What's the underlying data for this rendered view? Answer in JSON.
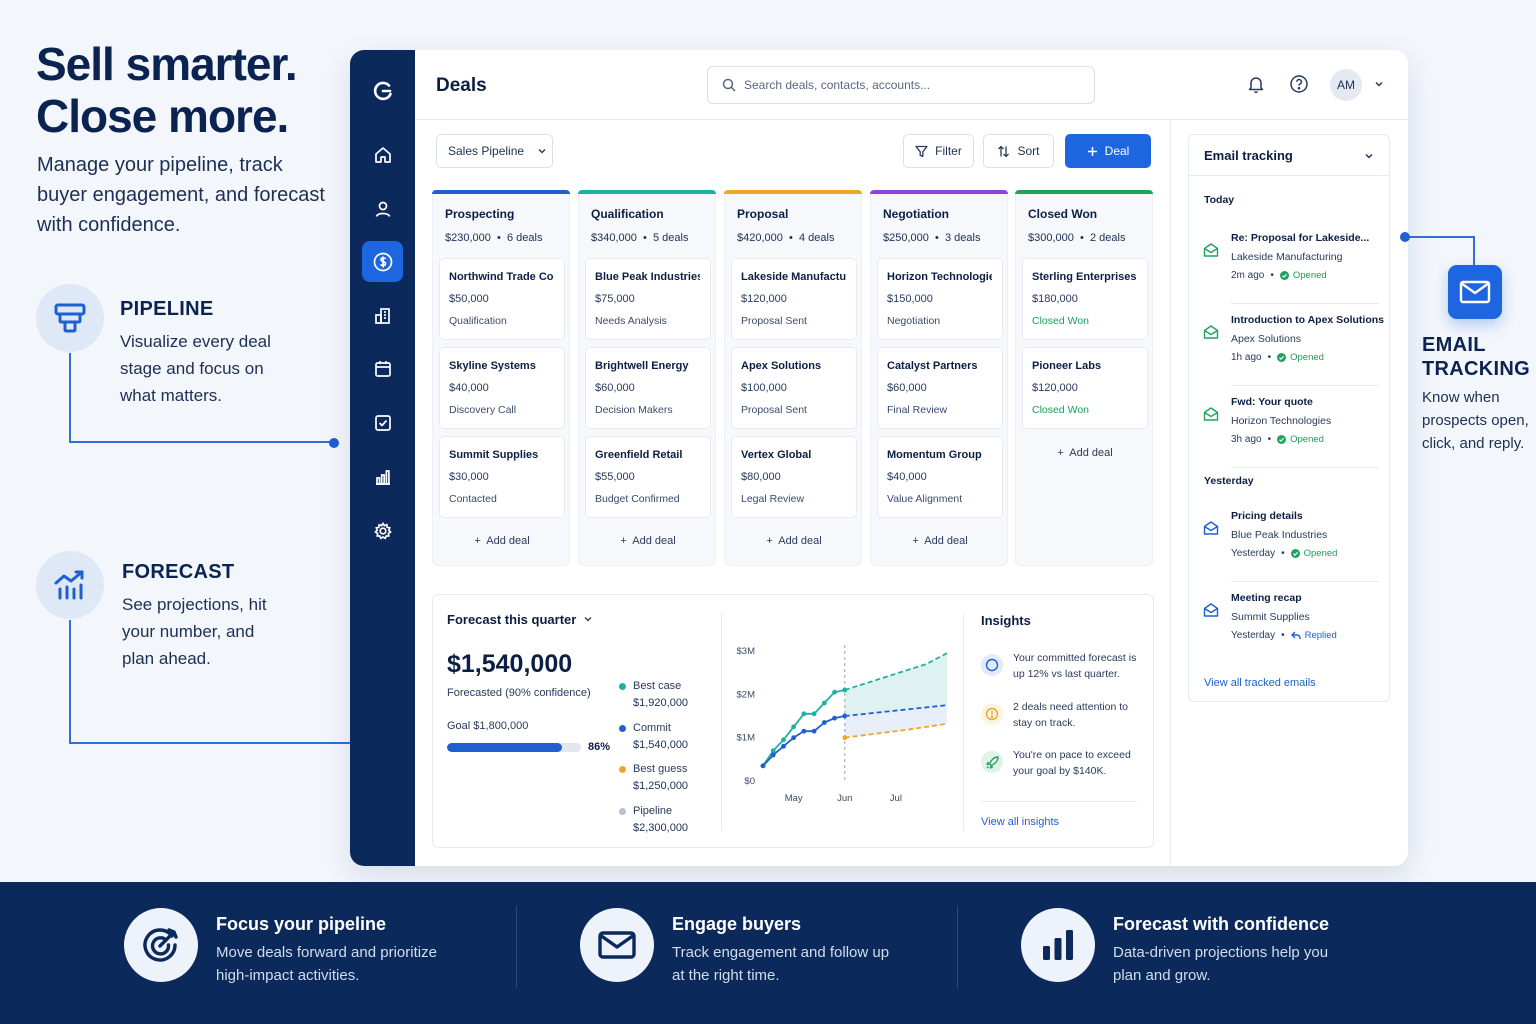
{
  "hero": {
    "title_line1": "Sell smarter.",
    "title_line2": "Close more.",
    "subtitle": "Manage your pipeline, track buyer engagement, and forecast with confidence."
  },
  "features": {
    "pipeline": {
      "title": "PIPELINE",
      "text": "Visualize every deal stage and focus on what matters."
    },
    "forecast": {
      "title": "FORECAST",
      "text": "See projections, hit your number, and plan ahead."
    },
    "email": {
      "title_line1": "EMAIL",
      "title_line2": "TRACKING",
      "text": "Know when prospects open, click, and reply."
    }
  },
  "app": {
    "page_title": "Deals",
    "search_placeholder": "Search deals, contacts, accounts...",
    "avatar_initials": "AM",
    "pipeline_select": "Sales Pipeline",
    "filter_label": "Filter",
    "sort_label": "Sort",
    "new_deal_label": "Deal",
    "add_deal_label": "Add deal",
    "columns": [
      {
        "name": "Prospecting",
        "total": "$230,000",
        "count": "6 deals",
        "color": "#1e5fd2",
        "cards": [
          {
            "name": "Northwind Trade Co.",
            "value": "$50,000",
            "stage": "Qualification"
          },
          {
            "name": "Skyline Systems",
            "value": "$40,000",
            "stage": "Discovery Call"
          },
          {
            "name": "Summit Supplies",
            "value": "$30,000",
            "stage": "Contacted"
          }
        ]
      },
      {
        "name": "Qualification",
        "total": "$340,000",
        "count": "5 deals",
        "color": "#1fb0a3",
        "cards": [
          {
            "name": "Blue Peak Industries",
            "value": "$75,000",
            "stage": "Needs Analysis"
          },
          {
            "name": "Brightwell Energy",
            "value": "$60,000",
            "stage": "Decision Makers"
          },
          {
            "name": "Greenfield Retail",
            "value": "$55,000",
            "stage": "Budget Confirmed"
          }
        ]
      },
      {
        "name": "Proposal",
        "total": "$420,000",
        "count": "4 deals",
        "color": "#f0a526",
        "cards": [
          {
            "name": "Lakeside Manufacturing",
            "value": "$120,000",
            "stage": "Proposal Sent"
          },
          {
            "name": "Apex Solutions",
            "value": "$100,000",
            "stage": "Proposal Sent"
          },
          {
            "name": "Vertex Global",
            "value": "$80,000",
            "stage": "Legal Review"
          }
        ]
      },
      {
        "name": "Negotiation",
        "total": "$250,000",
        "count": "3 deals",
        "color": "#8b46d6",
        "cards": [
          {
            "name": "Horizon Technologies",
            "value": "$150,000",
            "stage": "Negotiation"
          },
          {
            "name": "Catalyst Partners",
            "value": "$60,000",
            "stage": "Final Review"
          },
          {
            "name": "Momentum Group",
            "value": "$40,000",
            "stage": "Value Alignment"
          }
        ]
      },
      {
        "name": "Closed Won",
        "total": "$300,000",
        "count": "2 deals",
        "color": "#1fa35c",
        "cards": [
          {
            "name": "Sterling Enterprises",
            "value": "$180,000",
            "stage": "Closed Won"
          },
          {
            "name": "Pioneer Labs",
            "value": "$120,000",
            "stage": "Closed Won"
          }
        ]
      }
    ],
    "forecast": {
      "title": "Forecast this quarter",
      "amount": "$1,540,000",
      "subtitle": "Forecasted (90% confidence)",
      "goal": "Goal $1,800,000",
      "progress": 0.86,
      "progress_label": "86%",
      "legend": [
        {
          "name": "Best case",
          "value": "$1,920,000",
          "color": "#1fb0a3"
        },
        {
          "name": "Commit",
          "value": "$1,540,000",
          "color": "#1e5fd2"
        },
        {
          "name": "Best guess",
          "value": "$1,250,000",
          "color": "#f0a526"
        },
        {
          "name": "Pipeline",
          "value": "$2,300,000",
          "color": "#b8c1cf"
        }
      ]
    },
    "insights": {
      "title": "Insights",
      "items": [
        {
          "text": "Your committed forecast is up 12% vs last quarter.",
          "icon": "target-icon",
          "color": "#1e5fd2"
        },
        {
          "text": "2 deals need attention to stay on track.",
          "icon": "alert-icon",
          "color": "#f0a526"
        },
        {
          "text": "You're on pace to exceed your goal by $140K.",
          "icon": "rocket-icon",
          "color": "#1fa35c"
        }
      ],
      "link": "View all insights"
    },
    "email_tracking": {
      "title": "Email tracking",
      "groups": [
        {
          "label": "Today",
          "items": [
            {
              "subject": "Re: Proposal for Lakeside...",
              "account": "Lakeside Manufacturing",
              "when": "2m ago",
              "status": "Opened",
              "icon": "mail-open-icon"
            },
            {
              "subject": "Introduction to Apex Solutions",
              "account": "Apex Solutions",
              "when": "1h ago",
              "status": "Opened",
              "icon": "mail-open-icon"
            },
            {
              "subject": "Fwd: Your quote",
              "account": "Horizon Technologies",
              "when": "3h ago",
              "status": "Opened",
              "icon": "mail-open-icon"
            }
          ]
        },
        {
          "label": "Yesterday",
          "items": [
            {
              "subject": "Pricing details",
              "account": "Blue Peak Industries",
              "when": "Yesterday",
              "status": "Opened",
              "icon": "mail-icon"
            },
            {
              "subject": "Meeting recap",
              "account": "Summit Supplies",
              "when": "Yesterday",
              "status": "Replied",
              "icon": "mail-icon"
            }
          ]
        }
      ],
      "link": "View all tracked emails"
    }
  },
  "chart_data": {
    "type": "line",
    "categories": [
      "May",
      "Jun",
      "Jul"
    ],
    "y_ticks": [
      "$0",
      "$1M",
      "$2M",
      "$3M"
    ],
    "ylim": [
      0,
      3
    ],
    "y_unit": "$M",
    "series": [
      {
        "name": "Best case",
        "color": "#1fb0a3",
        "x": [
          0,
          0.5,
          1,
          1.5,
          2,
          2.5,
          3,
          3.5,
          4,
          5,
          6,
          7,
          8,
          9
        ],
        "values": [
          0.35,
          0.7,
          0.95,
          1.25,
          1.55,
          1.55,
          1.8,
          2.05,
          2.1,
          2.25,
          2.4,
          2.55,
          2.7,
          2.95
        ]
      },
      {
        "name": "Commit",
        "color": "#1e5fd2",
        "x": [
          0,
          0.5,
          1,
          1.5,
          2,
          2.5,
          3,
          3.5,
          4,
          5,
          6,
          7,
          8,
          9
        ],
        "values": [
          0.35,
          0.6,
          0.8,
          1.0,
          1.15,
          1.15,
          1.35,
          1.45,
          1.5,
          1.55,
          1.6,
          1.65,
          1.7,
          1.75
        ]
      },
      {
        "name": "Best guess",
        "color": "#f0a526",
        "x": [
          4,
          5,
          6,
          7,
          8,
          9
        ],
        "values": [
          1.0,
          1.06,
          1.12,
          1.18,
          1.25,
          1.32
        ]
      }
    ],
    "forecast_start_x": 4,
    "category_x": [
      1.5,
      4,
      6.5
    ]
  },
  "bottom": {
    "items": [
      {
        "title": "Focus your pipeline",
        "text": "Move deals forward and prioritize high-impact activities."
      },
      {
        "title": "Engage buyers",
        "text": "Track engagement and follow up at the right time."
      },
      {
        "title": "Forecast with confidence",
        "text": "Data-driven projections help you plan and grow."
      }
    ]
  }
}
